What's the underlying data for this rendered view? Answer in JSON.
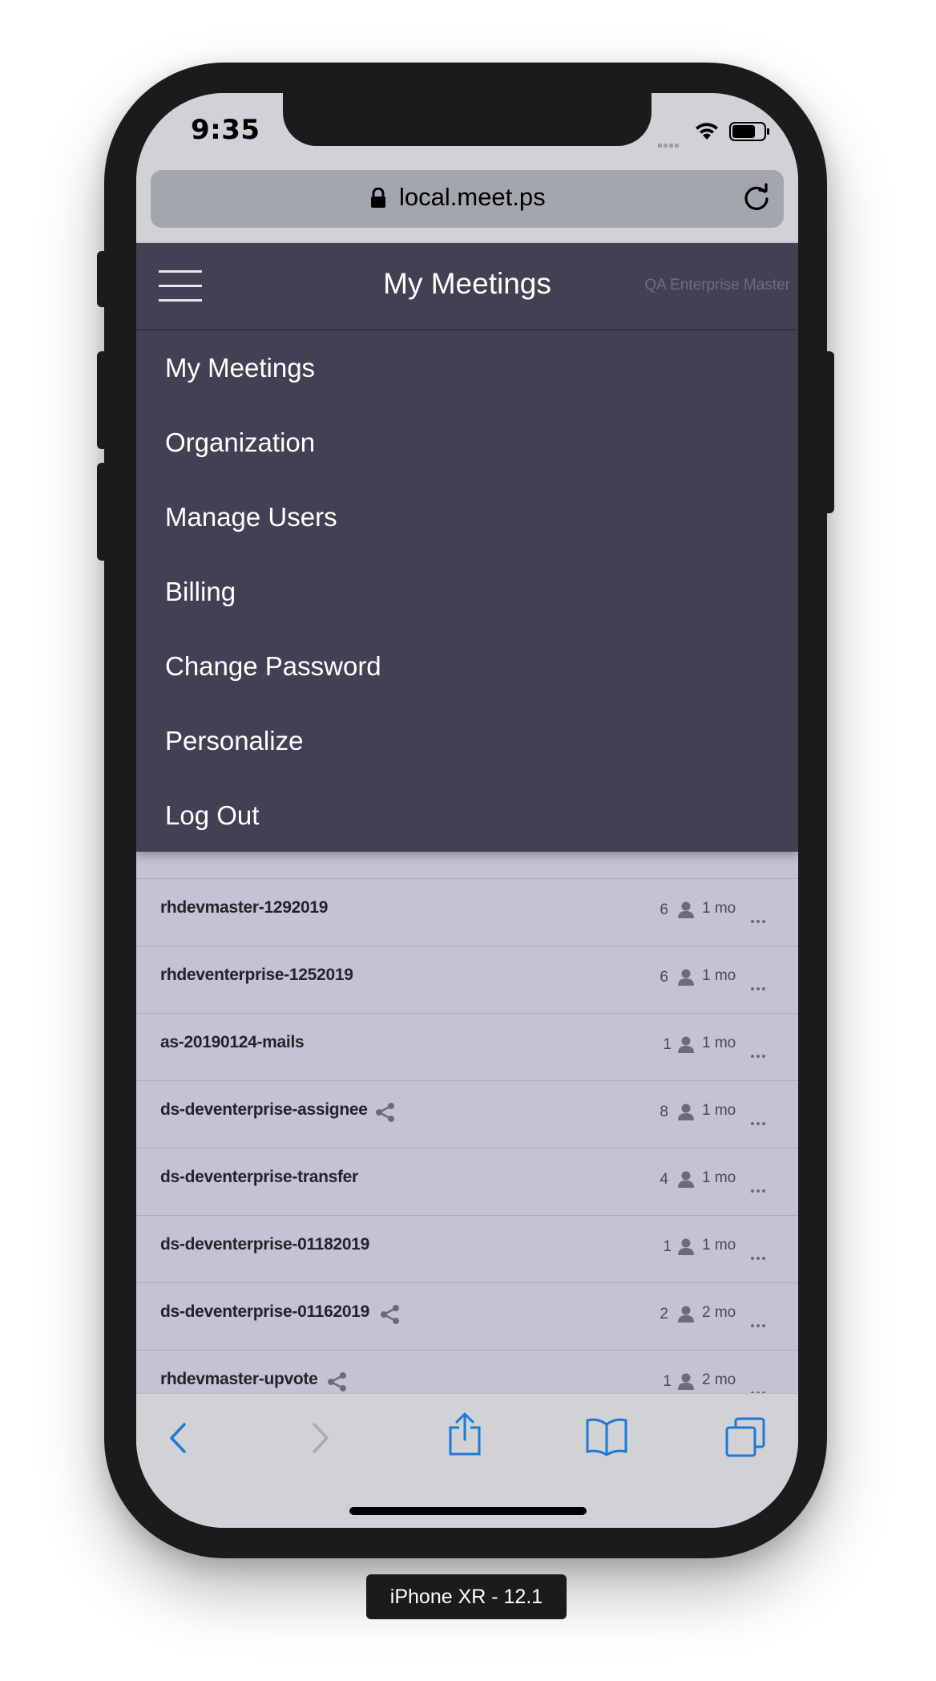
{
  "device": {
    "label": "iPhone XR - 12.1"
  },
  "status_bar": {
    "time": "9:35"
  },
  "browser": {
    "url": "local.meet.ps"
  },
  "app_header": {
    "title": "My Meetings",
    "org_name": "QA Enterprise Master"
  },
  "nav_menu": {
    "items": [
      {
        "label": "My Meetings"
      },
      {
        "label": "Organization"
      },
      {
        "label": "Manage Users"
      },
      {
        "label": "Billing"
      },
      {
        "label": "Change Password"
      },
      {
        "label": "Personalize"
      },
      {
        "label": "Log Out"
      }
    ]
  },
  "meetings": [
    {
      "name": "rhdevmaster-1292019",
      "shared": false,
      "participants": "6",
      "age": "1 mo"
    },
    {
      "name": "rhdeventerprise-1252019",
      "shared": false,
      "participants": "6",
      "age": "1 mo"
    },
    {
      "name": "as-20190124-mails",
      "shared": false,
      "participants": "1",
      "age": "1 mo"
    },
    {
      "name": "ds-deventerprise-assignee",
      "shared": true,
      "participants": "8",
      "age": "1 mo"
    },
    {
      "name": "ds-deventerprise-transfer",
      "shared": false,
      "participants": "4",
      "age": "1 mo"
    },
    {
      "name": "ds-deventerprise-01182019",
      "shared": false,
      "participants": "1",
      "age": "1 mo"
    },
    {
      "name": "ds-deventerprise-01162019",
      "shared": true,
      "participants": "2",
      "age": "2 mo"
    },
    {
      "name": "rhdevmaster-upvote",
      "shared": true,
      "participants": "1",
      "age": "2 mo"
    }
  ],
  "colors": {
    "header_bg": "#434054",
    "list_bg": "#c4c3d3",
    "ios_blue": "#1d78d6",
    "chrome_bg": "#d0d2d5"
  }
}
